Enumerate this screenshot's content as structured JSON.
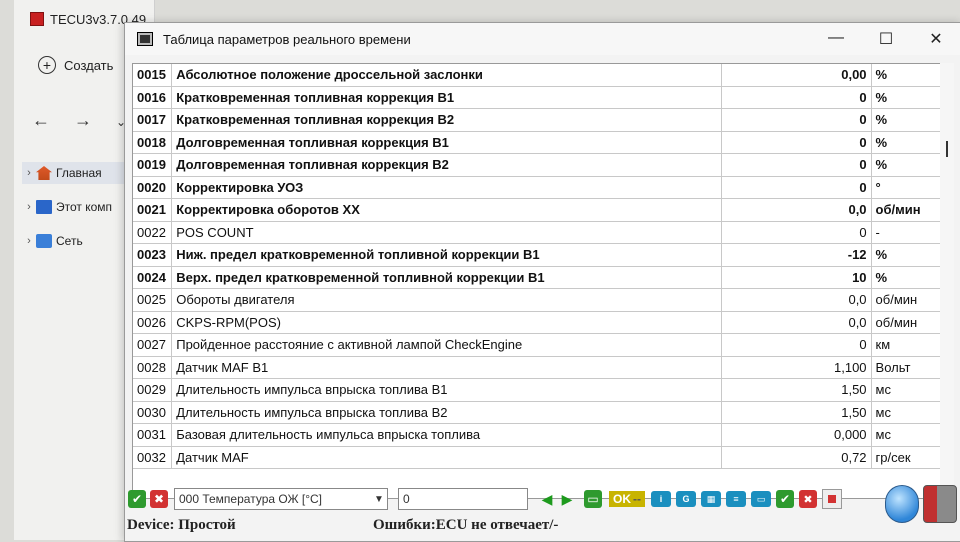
{
  "bg_window": {
    "title": "TECU3v3.7.0.49",
    "create_label": "Создать",
    "tree": [
      {
        "label": "Главная",
        "icon": "home-icon"
      },
      {
        "label": "Этот комп",
        "icon": "computer-icon"
      },
      {
        "label": "Сеть",
        "icon": "network-icon"
      }
    ]
  },
  "dialog": {
    "title": "Таблица параметров реального времени",
    "controls": {
      "minimize": "—",
      "maximize": "☐",
      "close": "✕"
    }
  },
  "table": {
    "rows": [
      {
        "id": "0015",
        "name": "Абсолютное положение дроссельной заслонки",
        "value": "0,00",
        "unit": "%",
        "bold": true
      },
      {
        "id": "0016",
        "name": "Кратковременная топливная коррекция B1",
        "value": "0",
        "unit": "%",
        "bold": true
      },
      {
        "id": "0017",
        "name": "Кратковременная топливная коррекция B2",
        "value": "0",
        "unit": "%",
        "bold": true
      },
      {
        "id": "0018",
        "name": "Долговременная топливная коррекция B1",
        "value": "0",
        "unit": "%",
        "bold": true
      },
      {
        "id": "0019",
        "name": "Долговременная топливная коррекция B2",
        "value": "0",
        "unit": "%",
        "bold": true
      },
      {
        "id": "0020",
        "name": "Корректировка УОЗ",
        "value": "0",
        "unit": "°",
        "bold": true
      },
      {
        "id": "0021",
        "name": "Корректировка оборотов ХХ",
        "value": "0,0",
        "unit": "об/мин",
        "bold": true
      },
      {
        "id": "0022",
        "name": "POS COUNT",
        "value": "0",
        "unit": "-",
        "bold": false
      },
      {
        "id": "0023",
        "name": "Ниж. предел кратковременной топливной коррекции B1",
        "value": "-12",
        "unit": "%",
        "bold": true
      },
      {
        "id": "0024",
        "name": "Верх. предел кратковременной топливной коррекции B1",
        "value": "10",
        "unit": "%",
        "bold": true
      },
      {
        "id": "0025",
        "name": "Обороты двигателя",
        "value": "0,0",
        "unit": "об/мин",
        "bold": false
      },
      {
        "id": "0026",
        "name": "CKPS-RPM(POS)",
        "value": "0,0",
        "unit": "об/мин",
        "bold": false
      },
      {
        "id": "0027",
        "name": "Пройденное расстояние с активной лампой CheckEngine",
        "value": "0",
        "unit": "км",
        "bold": false
      },
      {
        "id": "0028",
        "name": "Датчик MAF B1",
        "value": "1,100",
        "unit": "Вольт",
        "bold": false
      },
      {
        "id": "0029",
        "name": "Длительность импульса впрыска топлива B1",
        "value": "1,50",
        "unit": "мс",
        "bold": false
      },
      {
        "id": "0030",
        "name": "Длительность импульса впрыска топлива B2",
        "value": "1,50",
        "unit": "мс",
        "bold": false
      },
      {
        "id": "0031",
        "name": "Базовая длительность импульса впрыска топлива",
        "value": "0,000",
        "unit": "мс",
        "bold": false
      },
      {
        "id": "0032",
        "name": "Датчик MAF",
        "value": "0,72",
        "unit": "гр/сек",
        "bold": false
      }
    ]
  },
  "toolbar": {
    "param_select": "000 Температура ОЖ [°C]",
    "value_input": "0",
    "ok_indicator": "OK",
    "ok_suffix": "--"
  },
  "status": {
    "device": "Device: Простой",
    "errors": "Ошибки:ECU не отвечает/-"
  }
}
